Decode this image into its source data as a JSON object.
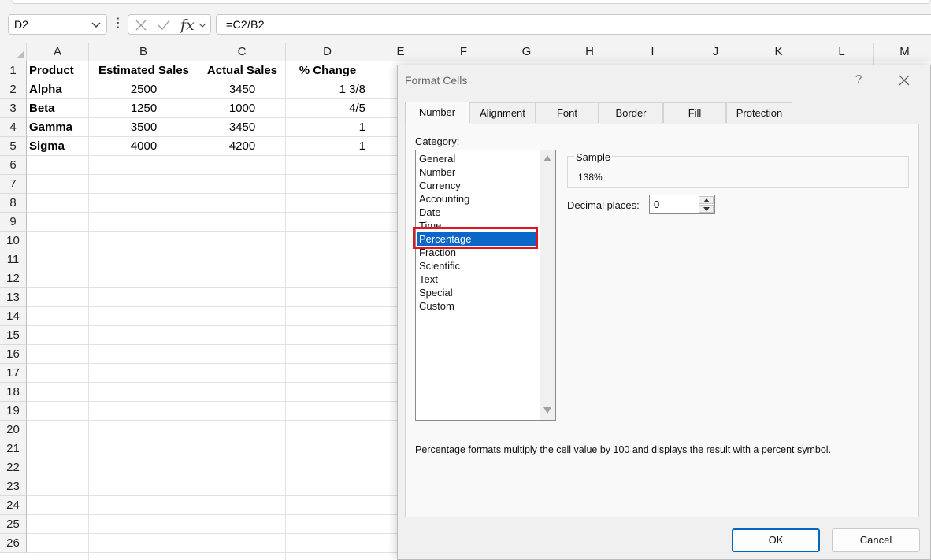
{
  "formula_bar": {
    "name_box": "D2",
    "formula": "=C2/B2",
    "fx_label": "fx"
  },
  "sheet": {
    "columns": [
      "A",
      "B",
      "C",
      "D",
      "E",
      "F",
      "G",
      "H",
      "I",
      "J",
      "K",
      "L",
      "M"
    ],
    "rows": [
      "1",
      "2",
      "3",
      "4",
      "5",
      "6",
      "7",
      "8",
      "9",
      "10",
      "11",
      "12",
      "13",
      "14",
      "15",
      "16",
      "17",
      "18",
      "19",
      "20",
      "21",
      "22",
      "23",
      "24",
      "25",
      "26"
    ],
    "headers": {
      "a": "Product",
      "b": "Estimated Sales",
      "c": "Actual Sales",
      "d": "% Change"
    },
    "data": [
      {
        "product": "Alpha",
        "estimated": "2500",
        "actual": "3450",
        "change": "1 3/8"
      },
      {
        "product": "Beta",
        "estimated": "1250",
        "actual": "1000",
        "change": "4/5"
      },
      {
        "product": "Gamma",
        "estimated": "3500",
        "actual": "3450",
        "change": "1"
      },
      {
        "product": "Sigma",
        "estimated": "4000",
        "actual": "4200",
        "change": "1"
      }
    ]
  },
  "dialog": {
    "title": "Format Cells",
    "help": "?",
    "tabs": [
      "Number",
      "Alignment",
      "Font",
      "Border",
      "Fill",
      "Protection"
    ],
    "active_tab": "Number",
    "category_label": "Category:",
    "categories": [
      "General",
      "Number",
      "Currency",
      "Accounting",
      "Date",
      "Time",
      "Percentage",
      "Fraction",
      "Scientific",
      "Text",
      "Special",
      "Custom"
    ],
    "selected_category": "Percentage",
    "sample_label": "Sample",
    "sample_value": "138%",
    "decimal_label": "Decimal places:",
    "decimal_value": "0",
    "description": "Percentage formats multiply the cell value by 100 and displays the result with a percent symbol.",
    "ok_label": "OK",
    "cancel_label": "Cancel"
  },
  "colors": {
    "selection": "#0a67c8",
    "highlight_box": "#e3141f",
    "ok_border": "#0067c0"
  }
}
